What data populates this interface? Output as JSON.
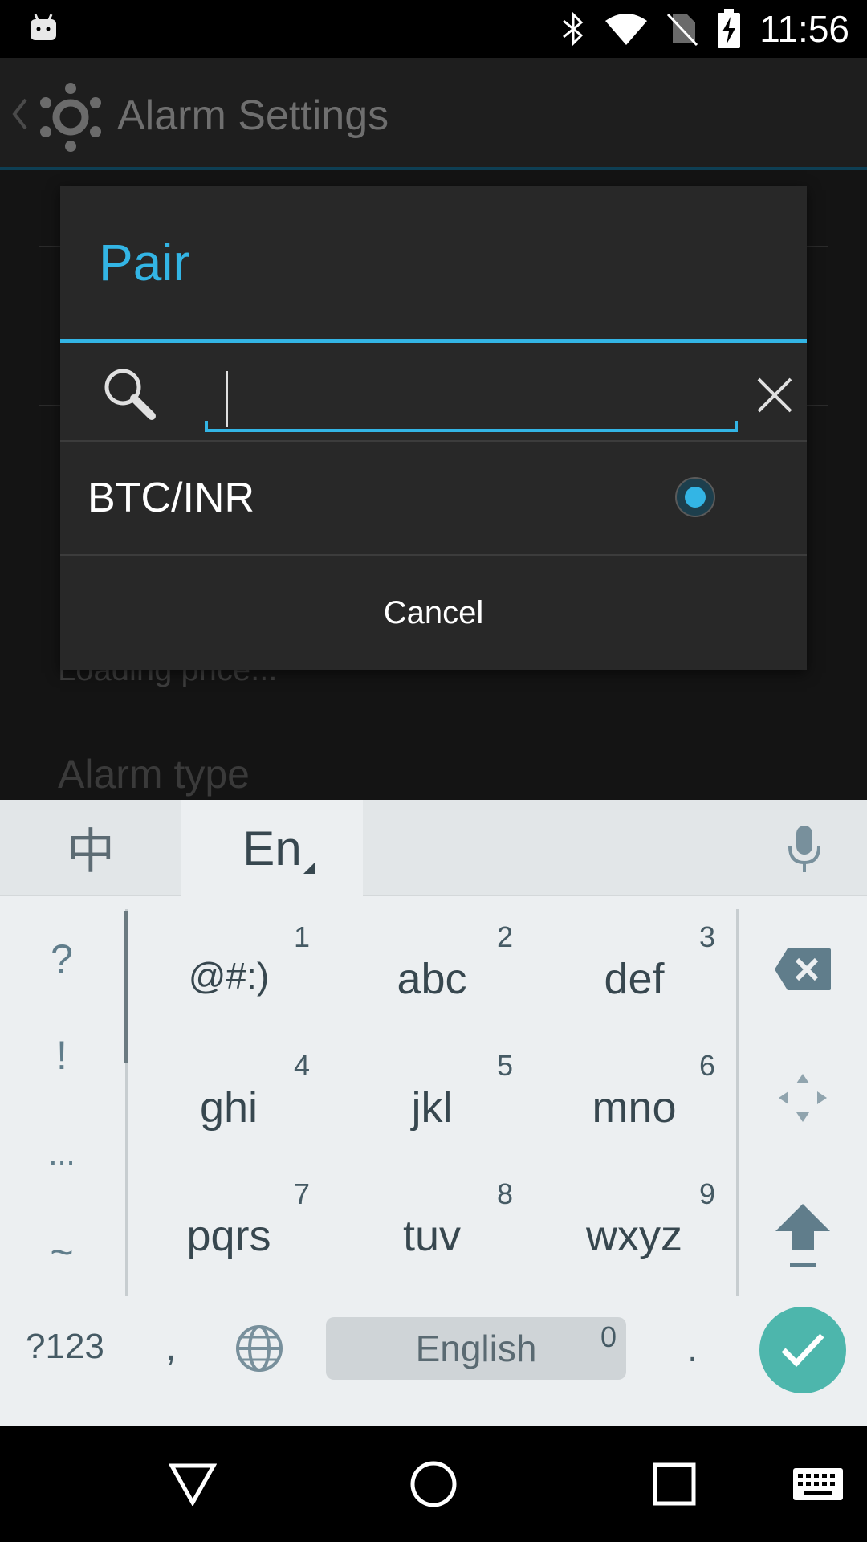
{
  "status_bar": {
    "time": "11:56",
    "icons": [
      "android-notification-icon",
      "bluetooth-icon",
      "wifi-icon",
      "no-sim-icon",
      "battery-charging-icon"
    ]
  },
  "app_bar": {
    "title": "Alarm Settings"
  },
  "background": {
    "loading_text": "Loading price...",
    "section_title": "Alarm type"
  },
  "dialog": {
    "title": "Pair",
    "search": {
      "value": "",
      "placeholder": ""
    },
    "options": [
      {
        "label": "BTC/INR",
        "selected": true
      }
    ],
    "cancel_label": "Cancel",
    "accent_color": "#33b5e5"
  },
  "keyboard": {
    "tabs": {
      "chinese": "中",
      "english": "En"
    },
    "punctuation": [
      "?",
      "!",
      "...",
      "~"
    ],
    "keys": [
      {
        "main": "@#:)",
        "num": "1"
      },
      {
        "main": "abc",
        "num": "2"
      },
      {
        "main": "def",
        "num": "3"
      },
      {
        "main": "ghi",
        "num": "4"
      },
      {
        "main": "jkl",
        "num": "5"
      },
      {
        "main": "mno",
        "num": "6"
      },
      {
        "main": "pqrs",
        "num": "7"
      },
      {
        "main": "tuv",
        "num": "8"
      },
      {
        "main": "wxyz",
        "num": "9"
      }
    ],
    "bottom_row": {
      "symbols_label": "?123",
      "comma": ",",
      "space_label": "English",
      "space_num": "0",
      "period": "."
    },
    "enter_color": "#4db6ac"
  },
  "nav_bar": {
    "buttons": [
      "back-triangle-icon",
      "home-circle-icon",
      "recents-square-icon",
      "keyboard-icon"
    ]
  }
}
